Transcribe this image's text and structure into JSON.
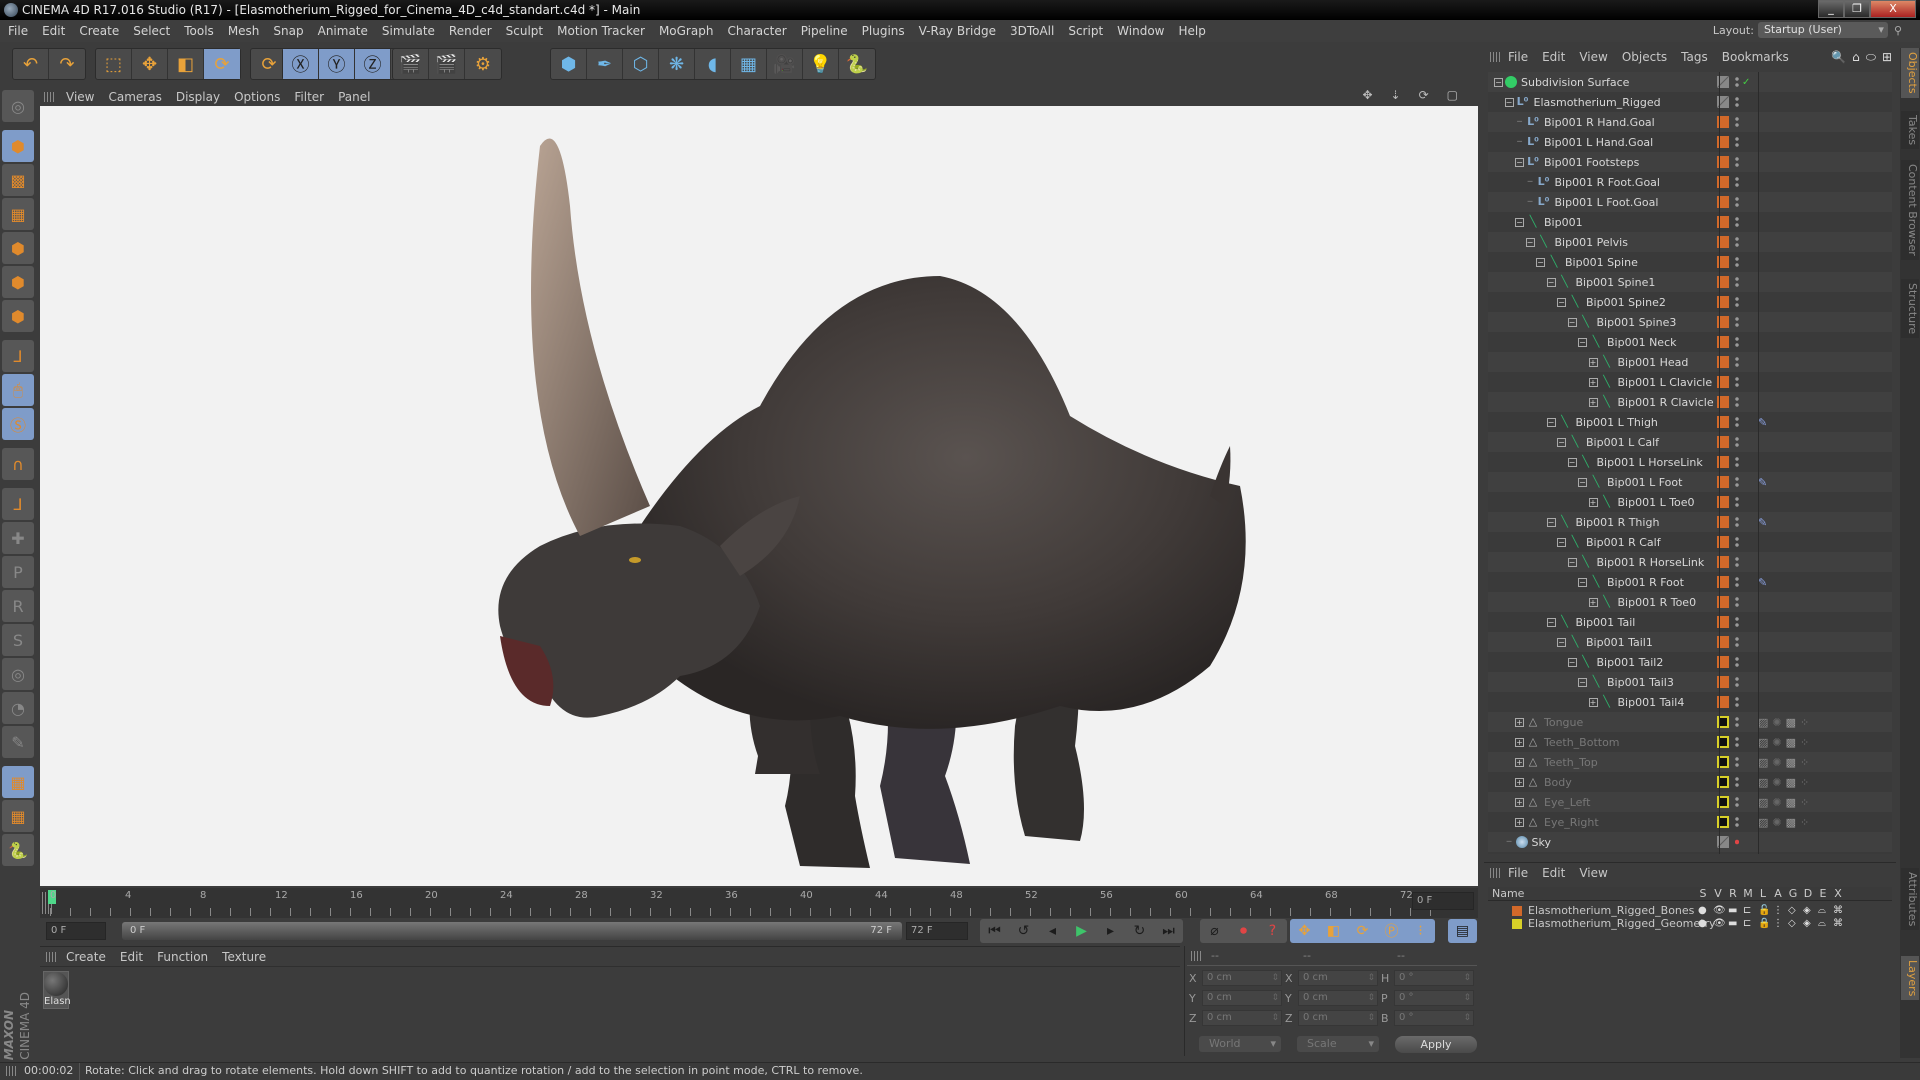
{
  "window": {
    "title": "CINEMA 4D R17.016 Studio (R17) - [Elasmotherium_Rigged_for_Cinema_4D_c4d_standart.c4d *] - Main",
    "minimize": "_",
    "restore": "❐",
    "close": "X"
  },
  "menubar": {
    "items": [
      "File",
      "Edit",
      "Create",
      "Select",
      "Tools",
      "Mesh",
      "Snap",
      "Animate",
      "Simulate",
      "Render",
      "Sculpt",
      "Motion Tracker",
      "MoGraph",
      "Character",
      "Pipeline",
      "Plugins",
      "V-Ray Bridge",
      "3DToAll",
      "Script",
      "Window",
      "Help"
    ],
    "layout_label": "Layout:",
    "layout_value": "Startup (User)"
  },
  "toolbar": {
    "groups": [
      {
        "buttons": [
          {
            "name": "undo",
            "glyph": "↶",
            "on": false
          },
          {
            "name": "redo",
            "glyph": "↷",
            "on": false
          }
        ]
      },
      {
        "buttons": [
          {
            "name": "live-selection",
            "glyph": "⬚",
            "on": false
          },
          {
            "name": "move",
            "glyph": "✥",
            "on": false
          },
          {
            "name": "scale",
            "glyph": "◧",
            "on": false
          },
          {
            "name": "rotate",
            "glyph": "⟳",
            "on": true
          }
        ]
      },
      {
        "buttons": [
          {
            "name": "recent-tools",
            "glyph": "⟳",
            "on": false
          }
        ]
      },
      {
        "buttons": [
          {
            "name": "x-axis",
            "glyph": "Ⓧ",
            "on": true
          },
          {
            "name": "y-axis",
            "glyph": "Ⓨ",
            "on": true
          },
          {
            "name": "z-axis",
            "glyph": "Ⓩ",
            "on": true
          },
          {
            "name": "coordinate-system",
            "glyph": "⬚",
            "on": false
          }
        ]
      },
      {
        "buttons": [
          {
            "name": "render-view",
            "glyph": "🎬",
            "on": false
          },
          {
            "name": "render-picture-viewer",
            "glyph": "🎬",
            "on": false
          },
          {
            "name": "render-settings",
            "glyph": "⚙",
            "on": false
          }
        ]
      },
      {
        "buttons": [
          {
            "name": "cube",
            "glyph": "⬢",
            "on": false
          },
          {
            "name": "pen",
            "glyph": "✒",
            "on": false
          },
          {
            "name": "subdivision",
            "glyph": "⬡",
            "on": false
          },
          {
            "name": "cloner",
            "glyph": "❋",
            "on": false
          },
          {
            "name": "deformer",
            "glyph": "◖",
            "on": false
          },
          {
            "name": "floor",
            "glyph": "▦",
            "on": false
          },
          {
            "name": "camera",
            "glyph": "🎥",
            "on": false
          },
          {
            "name": "light",
            "glyph": "💡",
            "on": false
          },
          {
            "name": "python",
            "glyph": "🐍",
            "on": false
          }
        ]
      }
    ]
  },
  "left_tools": [
    {
      "name": "make-editable",
      "glyph": "◎",
      "on": false,
      "dim": true
    },
    {
      "name": "model-mode",
      "glyph": "⬢",
      "on": true,
      "dim": false
    },
    {
      "name": "texture-mode",
      "glyph": "▩",
      "on": false,
      "dim": false
    },
    {
      "name": "workplane-mode",
      "glyph": "▦",
      "on": false,
      "dim": false
    },
    {
      "name": "points-mode",
      "glyph": "⬢",
      "on": false,
      "dim": false
    },
    {
      "name": "edges-mode",
      "glyph": "⬢",
      "on": false,
      "dim": false
    },
    {
      "name": "polygons-mode",
      "glyph": "⬢",
      "on": false,
      "dim": false
    },
    {
      "name": "axis-mode",
      "glyph": "⅃",
      "on": false,
      "dim": false
    },
    {
      "name": "tweak-mode",
      "glyph": "🖱",
      "on": true,
      "dim": false
    },
    {
      "name": "solo-mode",
      "glyph": "Ⓢ",
      "on": true,
      "dim": false
    },
    {
      "name": "snap",
      "glyph": "∩",
      "on": false,
      "dim": false
    },
    {
      "name": "workplane",
      "glyph": "⅃",
      "on": false,
      "dim": false
    },
    {
      "name": "add-joint",
      "glyph": "✚",
      "on": false,
      "dim": true
    },
    {
      "name": "ik-position",
      "glyph": "P",
      "on": false,
      "dim": true
    },
    {
      "name": "ik-rotation",
      "glyph": "R",
      "on": false,
      "dim": true
    },
    {
      "name": "ik-psr",
      "glyph": "S",
      "on": false,
      "dim": true
    },
    {
      "name": "ik-target",
      "glyph": "◎",
      "on": false,
      "dim": true
    },
    {
      "name": "ik-pole",
      "glyph": "◔",
      "on": false,
      "dim": true
    },
    {
      "name": "ik-misc",
      "glyph": "✎",
      "on": false,
      "dim": true
    },
    {
      "name": "lock-workplane",
      "glyph": "▦",
      "on": true,
      "dim": false
    },
    {
      "name": "workplane-rotate",
      "glyph": "▦",
      "on": false,
      "dim": false
    },
    {
      "name": "python-script",
      "glyph": "🐍",
      "on": false,
      "dim": false
    }
  ],
  "viewport": {
    "menu": [
      "View",
      "Cameras",
      "Display",
      "Options",
      "Filter",
      "Panel"
    ],
    "nav_icons": [
      "✥",
      "⇣",
      "⟳",
      "▢"
    ]
  },
  "timeline": {
    "ticks": [
      "0",
      "4",
      "8",
      "12",
      "16",
      "20",
      "24",
      "28",
      "32",
      "36",
      "40",
      "44",
      "48",
      "52",
      "56",
      "60",
      "64",
      "68",
      "72"
    ],
    "current_frame": "0 F",
    "start_frame": "0 F",
    "range_start": "0 F",
    "range_end": "72 F",
    "end_frame": "72 F",
    "transport": [
      "⏮",
      "↺",
      "◂",
      "▶",
      "▸",
      "↻",
      "⏭"
    ],
    "record": [
      "⌀",
      "⏺",
      "?"
    ],
    "key_buttons": [
      "✥",
      "◧",
      "⟳",
      "Ⓟ",
      "⁝"
    ],
    "timeline_button": "▤"
  },
  "material_manager": {
    "menu": [
      "Create",
      "Edit",
      "Function",
      "Texture"
    ],
    "materials": [
      {
        "label": "Elasn"
      }
    ]
  },
  "coordinates": {
    "headers": [
      "--",
      "--",
      "--"
    ],
    "rows": [
      {
        "l1": "X",
        "v1": "0 cm",
        "l2": "X",
        "v2": "0 cm",
        "l3": "H",
        "v3": "0 °"
      },
      {
        "l1": "Y",
        "v1": "0 cm",
        "l2": "Y",
        "v2": "0 cm",
        "l3": "P",
        "v3": "0 °"
      },
      {
        "l1": "Z",
        "v1": "0 cm",
        "l2": "Z",
        "v2": "0 cm",
        "l3": "B",
        "v3": "0 °"
      }
    ],
    "space_dropdown": "World",
    "mode_dropdown": "Scale",
    "apply_label": "Apply"
  },
  "status": {
    "time": "00:00:02",
    "message": "Rotate: Click and drag to rotate elements. Hold down SHIFT to add to quantize rotation / add to the selection in point mode, CTRL to remove."
  },
  "branding": {
    "maxon": "MAXON",
    "product": "CINEMA 4D"
  },
  "object_manager": {
    "menu": [
      "File",
      "Edit",
      "View",
      "Objects",
      "Tags",
      "Bookmarks"
    ],
    "icons": [
      "🔍",
      "⌂",
      "⬭",
      "⊞"
    ],
    "objects": [
      {
        "name": "Subdivision Surface",
        "depth": 0,
        "exp": "−",
        "type": "sub",
        "layer": "gray",
        "check": true,
        "dim": false,
        "tags": ""
      },
      {
        "name": "Elasmotherium_Rigged",
        "depth": 1,
        "exp": "−",
        "type": "null",
        "layer": "gray",
        "dim": false,
        "tags": ""
      },
      {
        "name": "Bip001 R Hand.Goal",
        "depth": 2,
        "exp": "",
        "type": "null",
        "layer": "orange",
        "dim": false,
        "tags": ""
      },
      {
        "name": "Bip001 L Hand.Goal",
        "depth": 2,
        "exp": "",
        "type": "null",
        "layer": "orange",
        "dim": false,
        "tags": ""
      },
      {
        "name": "Bip001 Footsteps",
        "depth": 2,
        "exp": "−",
        "type": "null",
        "layer": "orange",
        "dim": false,
        "tags": ""
      },
      {
        "name": "Bip001 R Foot.Goal",
        "depth": 3,
        "exp": "",
        "type": "null",
        "layer": "orange",
        "dim": false,
        "tags": ""
      },
      {
        "name": "Bip001 L Foot.Goal",
        "depth": 3,
        "exp": "",
        "type": "null",
        "layer": "orange",
        "dim": false,
        "tags": ""
      },
      {
        "name": "Bip001",
        "depth": 2,
        "exp": "−",
        "type": "bone",
        "layer": "orange",
        "dim": false,
        "tags": ""
      },
      {
        "name": "Bip001 Pelvis",
        "depth": 3,
        "exp": "−",
        "type": "bone",
        "layer": "orange",
        "dim": false,
        "tags": ""
      },
      {
        "name": "Bip001 Spine",
        "depth": 4,
        "exp": "−",
        "type": "bone",
        "layer": "orange",
        "dim": false,
        "tags": ""
      },
      {
        "name": "Bip001 Spine1",
        "depth": 5,
        "exp": "−",
        "type": "bone",
        "layer": "orange",
        "dim": false,
        "tags": ""
      },
      {
        "name": "Bip001 Spine2",
        "depth": 6,
        "exp": "−",
        "type": "bone",
        "layer": "orange",
        "dim": false,
        "tags": ""
      },
      {
        "name": "Bip001 Spine3",
        "depth": 7,
        "exp": "−",
        "type": "bone",
        "layer": "orange",
        "dim": false,
        "tags": ""
      },
      {
        "name": "Bip001 Neck",
        "depth": 8,
        "exp": "−",
        "type": "bone",
        "layer": "orange",
        "dim": false,
        "tags": ""
      },
      {
        "name": "Bip001 Head",
        "depth": 9,
        "exp": "+",
        "type": "bone",
        "layer": "orange",
        "dim": false,
        "tags": ""
      },
      {
        "name": "Bip001 L Clavicle",
        "depth": 9,
        "exp": "+",
        "type": "bone",
        "layer": "orange",
        "dim": false,
        "tags": ""
      },
      {
        "name": "Bip001 R Clavicle",
        "depth": 9,
        "exp": "+",
        "type": "bone",
        "layer": "orange",
        "dim": false,
        "tags": ""
      },
      {
        "name": "Bip001 L Thigh",
        "depth": 5,
        "exp": "−",
        "type": "bone",
        "layer": "orange",
        "dim": false,
        "tags": "ik"
      },
      {
        "name": "Bip001 L Calf",
        "depth": 6,
        "exp": "−",
        "type": "bone",
        "layer": "orange",
        "dim": false,
        "tags": ""
      },
      {
        "name": "Bip001 L HorseLink",
        "depth": 7,
        "exp": "−",
        "type": "bone",
        "layer": "orange",
        "dim": false,
        "tags": ""
      },
      {
        "name": "Bip001 L Foot",
        "depth": 8,
        "exp": "−",
        "type": "bone",
        "layer": "orange",
        "dim": false,
        "tags": "psr"
      },
      {
        "name": "Bip001 L Toe0",
        "depth": 9,
        "exp": "+",
        "type": "bone",
        "layer": "orange",
        "dim": false,
        "tags": ""
      },
      {
        "name": "Bip001 R Thigh",
        "depth": 5,
        "exp": "−",
        "type": "bone",
        "layer": "orange",
        "dim": false,
        "tags": "ik"
      },
      {
        "name": "Bip001 R Calf",
        "depth": 6,
        "exp": "−",
        "type": "bone",
        "layer": "orange",
        "dim": false,
        "tags": ""
      },
      {
        "name": "Bip001 R HorseLink",
        "depth": 7,
        "exp": "−",
        "type": "bone",
        "layer": "orange",
        "dim": false,
        "tags": ""
      },
      {
        "name": "Bip001 R Foot",
        "depth": 8,
        "exp": "−",
        "type": "bone",
        "layer": "orange",
        "dim": false,
        "tags": "psr"
      },
      {
        "name": "Bip001 R Toe0",
        "depth": 9,
        "exp": "+",
        "type": "bone",
        "layer": "orange",
        "dim": false,
        "tags": ""
      },
      {
        "name": "Bip001 Tail",
        "depth": 5,
        "exp": "−",
        "type": "bone",
        "layer": "orange",
        "dim": false,
        "tags": ""
      },
      {
        "name": "Bip001 Tail1",
        "depth": 6,
        "exp": "−",
        "type": "bone",
        "layer": "orange",
        "dim": false,
        "tags": ""
      },
      {
        "name": "Bip001 Tail2",
        "depth": 7,
        "exp": "−",
        "type": "bone",
        "layer": "orange",
        "dim": false,
        "tags": ""
      },
      {
        "name": "Bip001 Tail3",
        "depth": 8,
        "exp": "−",
        "type": "bone",
        "layer": "orange",
        "dim": false,
        "tags": ""
      },
      {
        "name": "Bip001 Tail4",
        "depth": 9,
        "exp": "+",
        "type": "bone",
        "layer": "orange",
        "dim": false,
        "tags": ""
      },
      {
        "name": "Tongue",
        "depth": 2,
        "exp": "+",
        "type": "poly",
        "layer": "yellow",
        "dim": true,
        "tags": "mesh"
      },
      {
        "name": "Teeth_Bottom",
        "depth": 2,
        "exp": "+",
        "type": "poly",
        "layer": "yellow",
        "dim": true,
        "tags": "mesh"
      },
      {
        "name": "Teeth_Top",
        "depth": 2,
        "exp": "+",
        "type": "poly",
        "layer": "yellow",
        "dim": true,
        "tags": "mesh"
      },
      {
        "name": "Body",
        "depth": 2,
        "exp": "+",
        "type": "poly",
        "layer": "yellow",
        "dim": true,
        "tags": "mesh"
      },
      {
        "name": "Eye_Left",
        "depth": 2,
        "exp": "+",
        "type": "poly",
        "layer": "yellow",
        "dim": true,
        "tags": "mesh"
      },
      {
        "name": "Eye_Right",
        "depth": 2,
        "exp": "+",
        "type": "poly",
        "layer": "yellow",
        "dim": true,
        "tags": "mesh"
      },
      {
        "name": "Sky",
        "depth": 1,
        "exp": "",
        "type": "sky",
        "layer": "gray",
        "dim": false,
        "tags": ""
      }
    ]
  },
  "layer_manager": {
    "menu": [
      "File",
      "Edit",
      "View"
    ],
    "columns": [
      "Name",
      "S",
      "V",
      "R",
      "M",
      "L",
      "A",
      "G",
      "D",
      "E",
      "X"
    ],
    "layers": [
      {
        "name": "Elasmotherium_Rigged_Bones",
        "color": "#d2692a",
        "locked": false
      },
      {
        "name": "Elasmotherium_Rigged_Geometry",
        "color": "#d8d028",
        "locked": true
      }
    ]
  },
  "side_tabs": {
    "top": [
      {
        "label": "Objects",
        "on": true
      },
      {
        "label": "Takes",
        "on": false
      },
      {
        "label": "Content Browser",
        "on": false
      },
      {
        "label": "Structure",
        "on": false
      }
    ],
    "bottom": [
      {
        "label": "Attributes",
        "on": false
      },
      {
        "label": "Layers",
        "on": true
      }
    ]
  },
  "colors": {
    "accent": "#7f9cc9",
    "layer_orange": "#d2692a",
    "layer_yellow": "#d8d028",
    "bone_green": "#2eb36b",
    "tab_active": "#e0a040"
  }
}
